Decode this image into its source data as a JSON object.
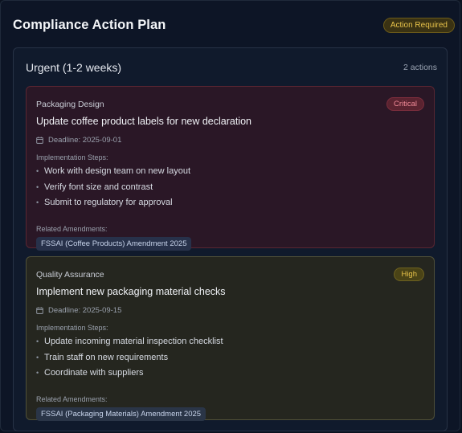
{
  "header": {
    "title": "Compliance Action Plan",
    "status_badge": "Action Required"
  },
  "section": {
    "title": "Urgent (1-2 weeks)",
    "count": "2 actions"
  },
  "labels": {
    "steps": "Implementation Steps:",
    "amendments": "Related Amendments:"
  },
  "actions": [
    {
      "category": "Packaging Design",
      "priority": "Critical",
      "title": "Update coffee product labels for new declaration",
      "deadline": "Deadline: 2025-09-01",
      "steps": [
        "Work with design team on new layout",
        "Verify font size and contrast",
        "Submit to regulatory for approval"
      ],
      "amendment": "FSSAI (Coffee Products) Amendment 2025"
    },
    {
      "category": "Quality Assurance",
      "priority": "High",
      "title": "Implement new packaging material checks",
      "deadline": "Deadline: 2025-09-15",
      "steps": [
        "Update incoming material inspection checklist",
        "Train staff on new requirements",
        "Coordinate with suppliers"
      ],
      "amendment": "FSSAI (Packaging Materials) Amendment 2025"
    }
  ],
  "colors": {
    "background": "#0d1526",
    "critical": "#f08a97",
    "high": "#e8c34a"
  },
  "icons": {
    "deadline": "calendar-icon",
    "step": "bullet-icon"
  }
}
